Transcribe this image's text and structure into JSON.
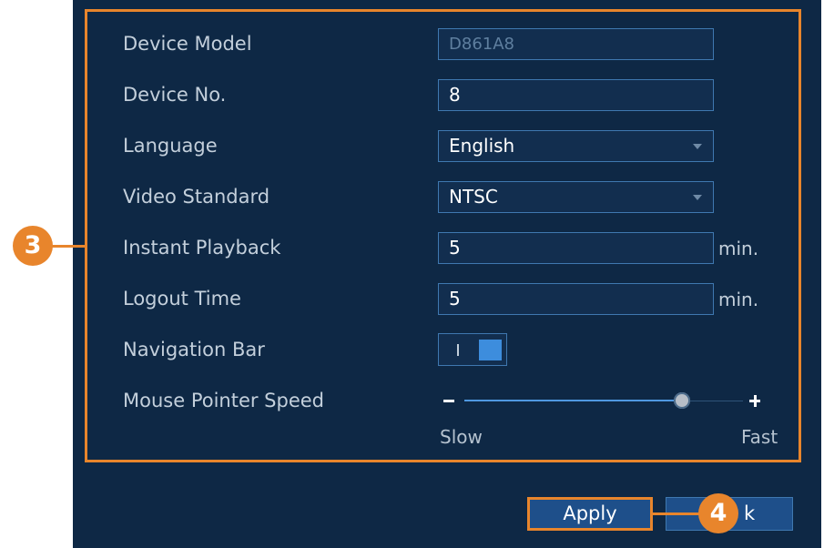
{
  "settings": {
    "device_model": {
      "label": "Device Model",
      "value": "D861A8"
    },
    "device_no": {
      "label": "Device No.",
      "value": "8"
    },
    "language": {
      "label": "Language",
      "value": "English"
    },
    "video_standard": {
      "label": "Video Standard",
      "value": "NTSC"
    },
    "instant_playback": {
      "label": "Instant Playback",
      "value": "5",
      "unit": "min."
    },
    "logout_time": {
      "label": "Logout Time",
      "value": "5",
      "unit": "min."
    },
    "navigation_bar": {
      "label": "Navigation Bar",
      "enabled": true
    },
    "mouse_pointer_speed": {
      "label": "Mouse Pointer Speed",
      "minus": "−",
      "plus": "+",
      "slow_label": "Slow",
      "fast_label": "Fast",
      "level": 0.78
    }
  },
  "buttons": {
    "apply": "Apply",
    "back_partial": "k"
  },
  "callouts": {
    "three": "3",
    "four": "4"
  },
  "colors": {
    "panel_bg": "#0e2845",
    "accent_orange": "#e8852c",
    "field_border": "#3f78b0",
    "toggle_on": "#3d8ddd",
    "button_bg": "#1e4f8a"
  },
  "icons": {
    "select_arrow": "caret-down-icon",
    "slider_thumb": "slider-thumb-icon"
  }
}
